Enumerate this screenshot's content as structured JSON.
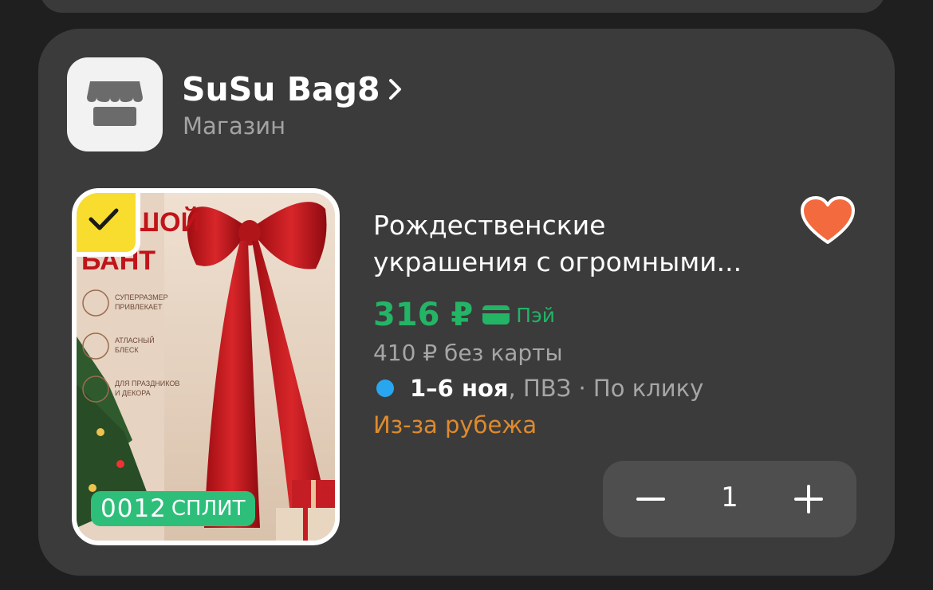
{
  "store": {
    "name": "SuSu Bag8",
    "subtitle": "Магазин",
    "logo_icon": "storefront-icon"
  },
  "product": {
    "title_line1": "Рождественские",
    "title_line2": "украшения с огромными...",
    "image_icon": "product-photo",
    "image_text": {
      "headline_top": "ШОЙ",
      "headline_bottom": "БАНТ",
      "features": [
        {
          "icon": "eye-icon",
          "line1": "СУПЕРРАЗМЕР",
          "line2": "ПРИВЛЕКАЕТ"
        },
        {
          "icon": "sparkle-icon",
          "line1": "АТЛАСНЫЙ",
          "line2": "БЛЕСК"
        },
        {
          "icon": "gift-icon",
          "line1": "ДЛЯ ПРАЗДНИКОВ",
          "line2": "И ДЕКОРА"
        }
      ]
    },
    "split_badge": {
      "number": "0012",
      "label": "СПЛИТ"
    },
    "price": "316 ₽",
    "pay_label": "Пэй",
    "old_price": "410 ₽  без карты",
    "delivery_date": "1–6 ноя",
    "delivery_rest": ", ПВЗ · По клику",
    "origin": "Из-за рубежа",
    "favorite": true,
    "quantity": "1"
  },
  "colors": {
    "accent_green": "#23b466",
    "heart": "#f26a3d",
    "origin_orange": "#e08a2c",
    "delivery_dot": "#28a7f0",
    "check_badge": "#f8dd2e"
  }
}
